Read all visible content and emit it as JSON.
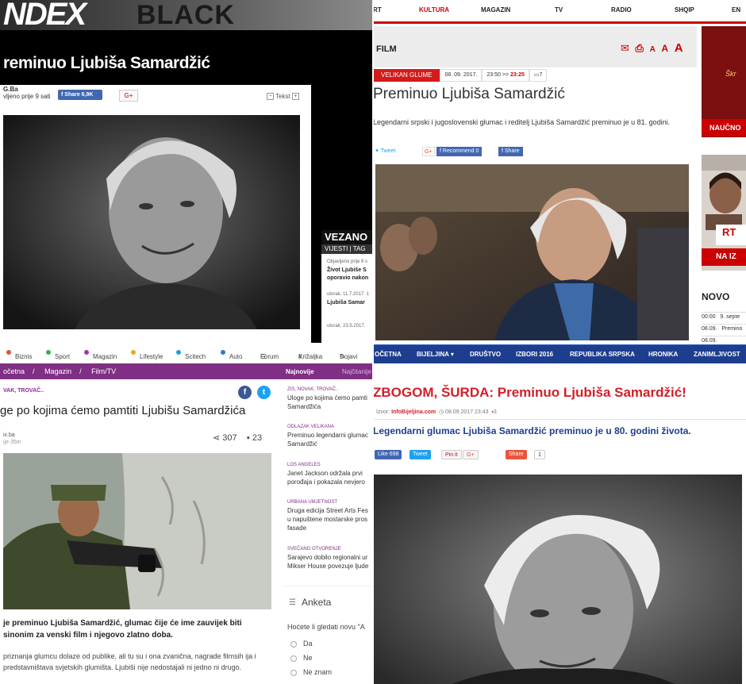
{
  "index": {
    "logo_main": "NDEX",
    "logo_black": "BLACK",
    "title": "reminuo Ljubiša Samardžić",
    "author": "G.Ba",
    "published": "vljeno prije 9 sati",
    "fb_share": "Share 6,9K",
    "gplus": "G+",
    "tekst": "Tekst",
    "vezano": "VEZANO",
    "tabs": "VIJESTI | TAG",
    "side_items": [
      {
        "date": "Objavljeno prije 8 s",
        "text": "Život Ljubiše S"
      },
      {
        "date": "",
        "text": "oporavio nakon"
      },
      {
        "date": "utorak, 11.7.2017. 1",
        "text": "Ljubiša Samar"
      },
      {
        "date": "utorak, 23.5.2017.",
        "text": ""
      }
    ]
  },
  "rts": {
    "nav": [
      "RT",
      "KULTURA",
      "MAGAZIN",
      "TV",
      "RADIO",
      "SHQIP",
      "EN"
    ],
    "nav_active": "KULTURA",
    "section": "FILM",
    "tool_icons": [
      "envelope-icon",
      "printer-icon"
    ],
    "font_sizes": [
      "A",
      "A",
      "A"
    ],
    "badge": "VELIKAN GLUME",
    "date": "08. 09. 2017.",
    "time": "23:50",
    "updated_arrows": ">>",
    "updated": "23:25",
    "comments": "7",
    "title": "Preminuo Ljubiša Samardžić",
    "lead": "Legendarni srpski i jugoslovenski glumac i reditelj Ljubiša Samardžić preminuo je u 81. godini.",
    "social": [
      "Tweet",
      "G+",
      "Recommend 0",
      "Share"
    ],
    "ad_text": "Škr",
    "nauc": "NAUČNO",
    "rt_logo": "RT",
    "na_iz": "NA IZ",
    "novo": "NOVO",
    "novo_items": [
      {
        "time": "00:00",
        "text": "9. septe"
      },
      {
        "time": "08.09.",
        "text": "Premino"
      },
      {
        "time": "08.09.",
        "text": ""
      }
    ]
  },
  "klix": {
    "categories": [
      {
        "label": "Biznis",
        "color": "#e0533a"
      },
      {
        "label": "Sport",
        "color": "#3fae49"
      },
      {
        "label": "Magazin",
        "color": "#a33aa7"
      },
      {
        "label": "Lifestyle",
        "color": "#f0a61f"
      },
      {
        "label": "Scitech",
        "color": "#1aa3d9"
      },
      {
        "label": "Auto",
        "color": "#3575c9"
      },
      {
        "label": "Forum",
        "color": ""
      },
      {
        "label": "Križaljka",
        "color": ""
      },
      {
        "label": "Dojavi",
        "color": ""
      }
    ],
    "crumbs": [
      "očetna",
      "/",
      "Magazin",
      "/",
      "Film/TV"
    ],
    "tab_active": "Najnovije",
    "tab_other": "Najčitanije",
    "tag": "VAK, TROVAČ..",
    "title": "ge po kojima ćemo pamtiti Ljubišu Samardžića",
    "source": "ix.ba",
    "time": "ije 35m",
    "shares": "307",
    "comments": "23",
    "lead": "je preminuo Ljubiša Samardžić, glumac čije će ime zauvijek biti sinonim za venski film i njegovo zlatno doba.",
    "body": "priznanja glumcu dolaze od publike, ali tu su i ona zvanična, nagrade filmsih ija i predstavništava svjetskih glumišta. Ljubiši nije nedostajali ni jedno ni drugo.",
    "news": [
      {
        "cat": "ZIS, NOVAK, TROVAČ..",
        "lines": [
          "Uloge po kojima ćemo pamti",
          "Samardžića"
        ]
      },
      {
        "cat": "ODLAZAK VELIKANA",
        "lines": [
          "Preminuo legendarni glumac",
          "Samardžić"
        ]
      },
      {
        "cat": "LOS ANGELES",
        "lines": [
          "Janet Jackson održala prvi",
          "porođaja i pokazala nevjero"
        ]
      },
      {
        "cat": "URBANA UMJETNOST",
        "lines": [
          "Druga edicija Street Arts Fes",
          "u napuštene mostarske pros",
          "fasade"
        ]
      },
      {
        "cat": "SVEČANO OTVORENJE",
        "lines": [
          "Sarajevo dobilo regionalni ur",
          "Mikser House povezuje ljude"
        ]
      }
    ],
    "anketa": "Anketa",
    "question": "Hoćete li gledati novu \"A",
    "options": [
      "Da",
      "Ne",
      "Ne znam"
    ]
  },
  "infobijeljina": {
    "nav": [
      "OČETNA",
      "BIJELJINA ▾",
      "DRUŠTVO",
      "IZBORI 2016",
      "REPUBLIKA SRPSKA",
      "HRONIKA",
      "ZANIMLJIVOST"
    ],
    "title": "ZBOGOM, ŠURDA: Preminuo Ljubiša Samardžić!",
    "meta_prefix": "Izvor:",
    "meta_source": "InfoBijeljina.com",
    "meta_date": "08.09.2017 23:43",
    "meta_comments": "3",
    "lead": "Legendarni glumac Ljubiša Samardžić preminuo je u 80. godini života.",
    "share": [
      {
        "label": "Like 698",
        "bg": "#4267b2",
        "fg": "#ffffff"
      },
      {
        "label": "Tweet",
        "bg": "#1da1f2",
        "fg": "#ffffff"
      },
      {
        "label": "Pin it",
        "bg": "#f6f6f6",
        "fg": "#bd081c"
      },
      {
        "label": "G+",
        "bg": "#f6f6f6",
        "fg": "#d34836"
      },
      {
        "label": "Share",
        "bg": "#e9563c",
        "fg": "#ffffff"
      },
      {
        "label": "1",
        "bg": "#ffffff",
        "fg": "#333333"
      }
    ]
  }
}
